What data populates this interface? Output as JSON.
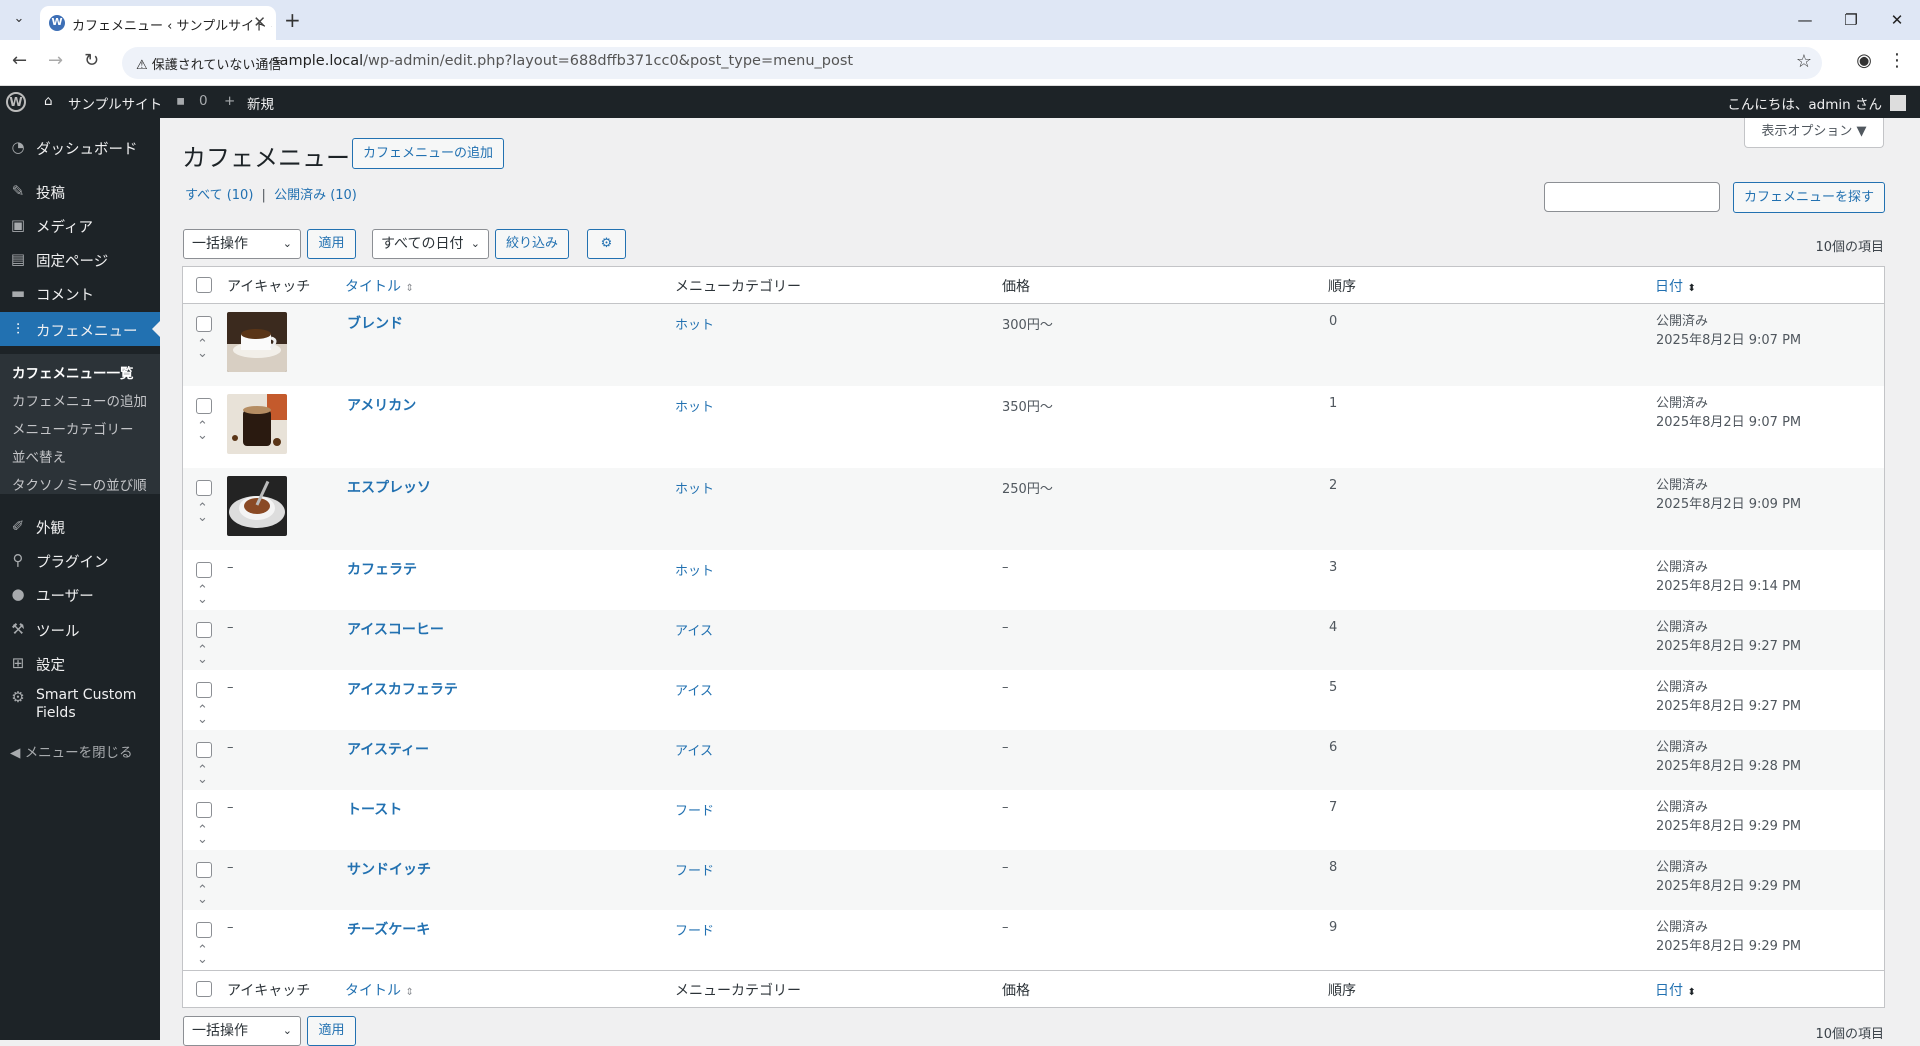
{
  "browser": {
    "tab_title": "カフェメニュー ‹ サンプルサイト — Wo",
    "security_label": "保護されていない通信",
    "url_host": "sample.local",
    "url_path": "/wp-admin/edit.php?layout=688dffb371cc0&post_type=menu_post"
  },
  "adminbar": {
    "site_name": "サンプルサイト",
    "comments_count": "0",
    "new_label": "新規",
    "greeting": "こんにちは、admin さん"
  },
  "sidebar": {
    "items": [
      {
        "label": "ダッシュボード",
        "icon": "dashboard-icon"
      },
      {
        "label": "投稿",
        "icon": "pin-icon"
      },
      {
        "label": "メディア",
        "icon": "media-icon"
      },
      {
        "label": "固定ページ",
        "icon": "page-icon"
      },
      {
        "label": "コメント",
        "icon": "comment-icon"
      },
      {
        "label": "カフェメニュー",
        "icon": "food-icon"
      },
      {
        "label": "外観",
        "icon": "brush-icon"
      },
      {
        "label": "プラグイン",
        "icon": "plugin-icon"
      },
      {
        "label": "ユーザー",
        "icon": "user-icon"
      },
      {
        "label": "ツール",
        "icon": "wrench-icon"
      },
      {
        "label": "設定",
        "icon": "settings-icon"
      },
      {
        "label": "Smart Custom",
        "label2": "Fields",
        "icon": "gear-icon"
      }
    ],
    "submenu": [
      "カフェメニュー一覧",
      "カフェメニューの追加",
      "メニューカテゴリー",
      "並べ替え",
      "タクソノミーの並び順"
    ],
    "collapse": "メニューを閉じる"
  },
  "page": {
    "title": "カフェメニュー",
    "add_new": "カフェメニューの追加",
    "screen_options": "表示オプション ▼",
    "view_all": "すべて (10)",
    "view_sep": "|",
    "view_published": "公開済み (10)",
    "search_button": "カフェメニューを探す",
    "bulk_action": "一括操作",
    "apply": "適用",
    "date_filter": "すべての日付",
    "filter_button": "絞り込み",
    "item_count": "10個の項目"
  },
  "table": {
    "headers": {
      "thumbnail": "アイキャッチ",
      "title": "タイトル",
      "category": "メニューカテゴリー",
      "price": "価格",
      "order": "順序",
      "date": "日付"
    },
    "rows": [
      {
        "title": "ブレンド",
        "category": "ホット",
        "price": "300円〜",
        "order": "0",
        "status": "公開済み",
        "date": "2025年8月2日 9:07 PM",
        "thumb": "coffee-cup"
      },
      {
        "title": "アメリカン",
        "category": "ホット",
        "price": "350円〜",
        "order": "1",
        "status": "公開済み",
        "date": "2025年8月2日 9:07 PM",
        "thumb": "glass-coffee"
      },
      {
        "title": "エスプレッソ",
        "category": "ホット",
        "price": "250円〜",
        "order": "2",
        "status": "公開済み",
        "date": "2025年8月2日 9:09 PM",
        "thumb": "espresso"
      },
      {
        "title": "カフェラテ",
        "category": "ホット",
        "price": "–",
        "order": "3",
        "status": "公開済み",
        "date": "2025年8月2日 9:14 PM",
        "thumb": "–"
      },
      {
        "title": "アイスコーヒー",
        "category": "アイス",
        "price": "–",
        "order": "4",
        "status": "公開済み",
        "date": "2025年8月2日 9:27 PM",
        "thumb": "–"
      },
      {
        "title": "アイスカフェラテ",
        "category": "アイス",
        "price": "–",
        "order": "5",
        "status": "公開済み",
        "date": "2025年8月2日 9:27 PM",
        "thumb": "–"
      },
      {
        "title": "アイスティー",
        "category": "アイス",
        "price": "–",
        "order": "6",
        "status": "公開済み",
        "date": "2025年8月2日 9:28 PM",
        "thumb": "–"
      },
      {
        "title": "トースト",
        "category": "フード",
        "price": "–",
        "order": "7",
        "status": "公開済み",
        "date": "2025年8月2日 9:29 PM",
        "thumb": "–"
      },
      {
        "title": "サンドイッチ",
        "category": "フード",
        "price": "–",
        "order": "8",
        "status": "公開済み",
        "date": "2025年8月2日 9:29 PM",
        "thumb": "–"
      },
      {
        "title": "チーズケーキ",
        "category": "フード",
        "price": "–",
        "order": "9",
        "status": "公開済み",
        "date": "2025年8月2日 9:29 PM",
        "thumb": "–"
      }
    ]
  },
  "colors": {
    "accent": "#2271b1",
    "admin_bg": "#1d2327",
    "content_bg": "#f0f0f1"
  }
}
